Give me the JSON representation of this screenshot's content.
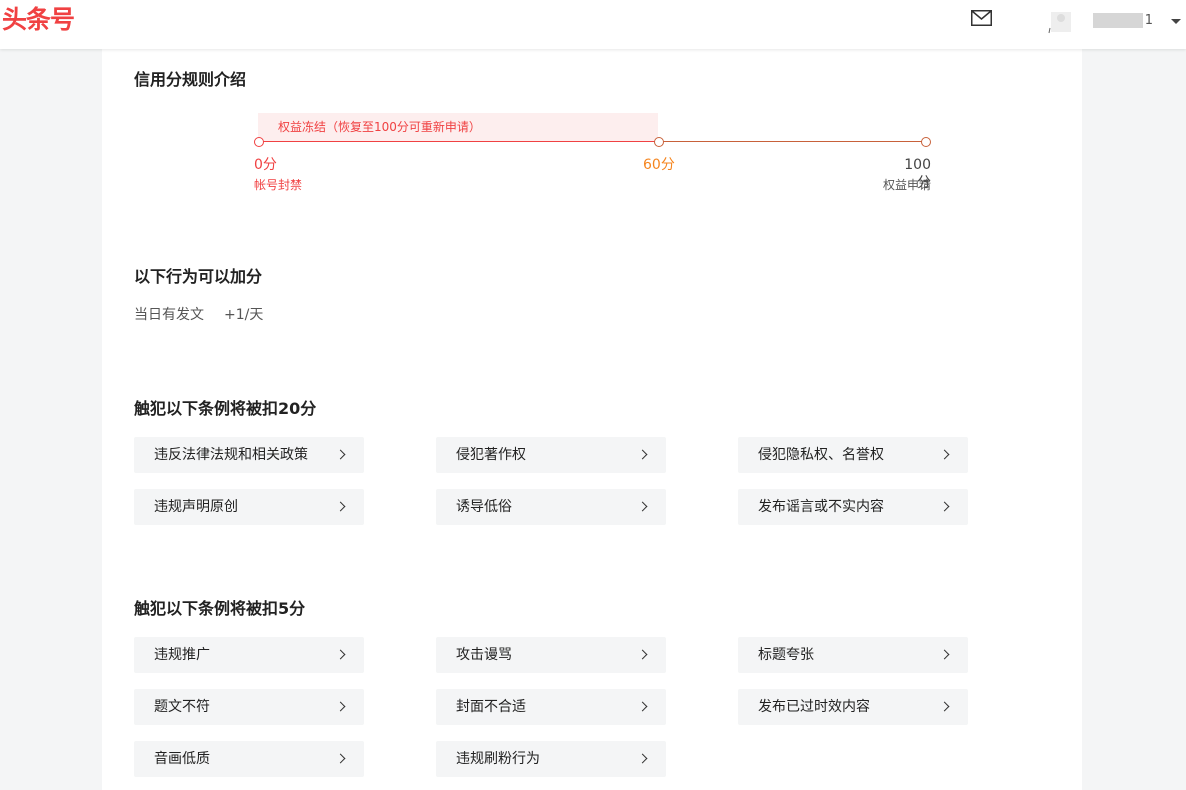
{
  "header": {
    "logo": "头条号",
    "username_suffix": "1"
  },
  "intro": {
    "title": "信用分规则介绍",
    "freeze_text": "权益冻结（恢复至100分可重新申请）",
    "points": [
      {
        "score": "0分",
        "note": "帐号封禁",
        "color": "#f04142"
      },
      {
        "score": "60分",
        "note": "",
        "color": "#f5851f"
      },
      {
        "score": "100分",
        "note": "权益申请",
        "color": "#444444"
      }
    ],
    "line_color_left": "#f04142",
    "line_color_right": "#c8613a"
  },
  "plus": {
    "title": "以下行为可以加分",
    "item": "当日有发文",
    "value": "+1/天"
  },
  "deduct20": {
    "title": "触犯以下条例将被扣20分",
    "items": [
      "违反法律法规和相关政策",
      "侵犯著作权",
      "侵犯隐私权、名誉权",
      "违规声明原创",
      "诱导低俗",
      "发布谣言或不实内容"
    ]
  },
  "deduct5": {
    "title": "触犯以下条例将被扣5分",
    "items": [
      "违规推广",
      "攻击谩骂",
      "标题夸张",
      "题文不符",
      "封面不合适",
      "发布已过时效内容",
      "音画低质",
      "违规刷粉行为"
    ]
  }
}
